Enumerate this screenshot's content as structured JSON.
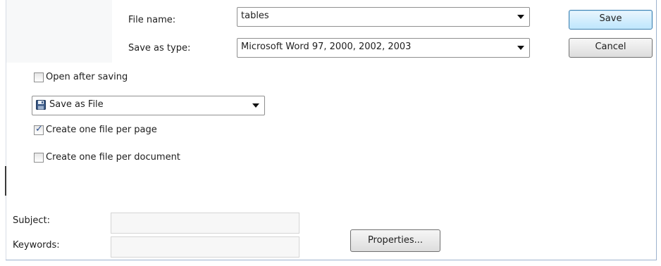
{
  "file_name": {
    "label": "File name:",
    "value": "tables"
  },
  "save_as_type": {
    "label": "Save as type:",
    "value": "Microsoft Word 97, 2000, 2002, 2003"
  },
  "buttons": {
    "save": "Save",
    "cancel": "Cancel",
    "properties": "Properties..."
  },
  "options": {
    "open_after_saving": {
      "label": "Open after saving",
      "checked": false
    },
    "save_mode": {
      "label": "Save as File",
      "icon": "floppy-disk-icon"
    },
    "one_file_per_page": {
      "label": "Create one file per page",
      "checked": true
    },
    "one_file_per_document": {
      "label": "Create one file per document",
      "checked": false
    }
  },
  "metadata": {
    "subject_label": "Subject:",
    "subject_value": "",
    "keywords_label": "Keywords:",
    "keywords_value": ""
  },
  "colors": {
    "default_button_border": "#3c7fb1",
    "default_button_fill": "#bee6fd",
    "check_color": "#2a4f8f"
  }
}
